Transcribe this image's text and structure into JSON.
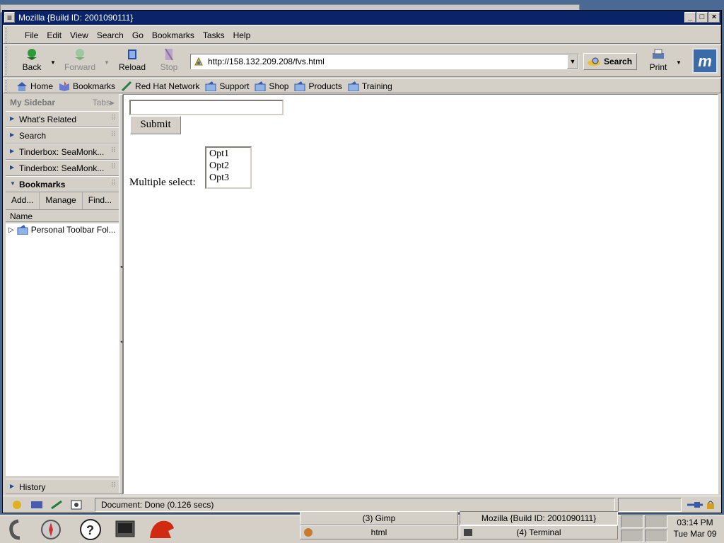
{
  "window": {
    "title": "Mozilla {Build ID: 2001090111}"
  },
  "menu": [
    "File",
    "Edit",
    "View",
    "Search",
    "Go",
    "Bookmarks",
    "Tasks",
    "Help"
  ],
  "nav": {
    "back": "Back",
    "forward": "Forward",
    "reload": "Reload",
    "stop": "Stop",
    "url": "http://158.132.209.208/fvs.html",
    "search": "Search",
    "print": "Print"
  },
  "personal_toolbar": [
    "Home",
    "Bookmarks",
    "Red Hat Network",
    "Support",
    "Shop",
    "Products",
    "Training"
  ],
  "sidebar": {
    "title": "My Sidebar",
    "tabs": "Tabs",
    "panels": [
      "What's Related",
      "Search",
      "Tinderbox: SeaMonk...",
      "Tinderbox: SeaMonk..."
    ],
    "bookmarks": {
      "title": "Bookmarks",
      "add": "Add...",
      "manage": "Manage",
      "find": "Find...",
      "column": "Name",
      "item": "Personal Toolbar Fol..."
    },
    "history": "History"
  },
  "page": {
    "text_value": "",
    "submit": "Submit",
    "multi_label": "Multiple select:",
    "options": [
      "Opt1",
      "Opt2",
      "Opt3"
    ]
  },
  "status": {
    "text": "Document: Done (0.126 secs)"
  },
  "taskbar": {
    "tasks": [
      {
        "label": "(3) Gimp"
      },
      {
        "label": "Mozilla {Build ID: 2001090111}"
      },
      {
        "label": "html"
      },
      {
        "label": "(4) Terminal"
      }
    ],
    "clock": {
      "time": "03:14 PM",
      "date": "Tue Mar 09"
    }
  }
}
